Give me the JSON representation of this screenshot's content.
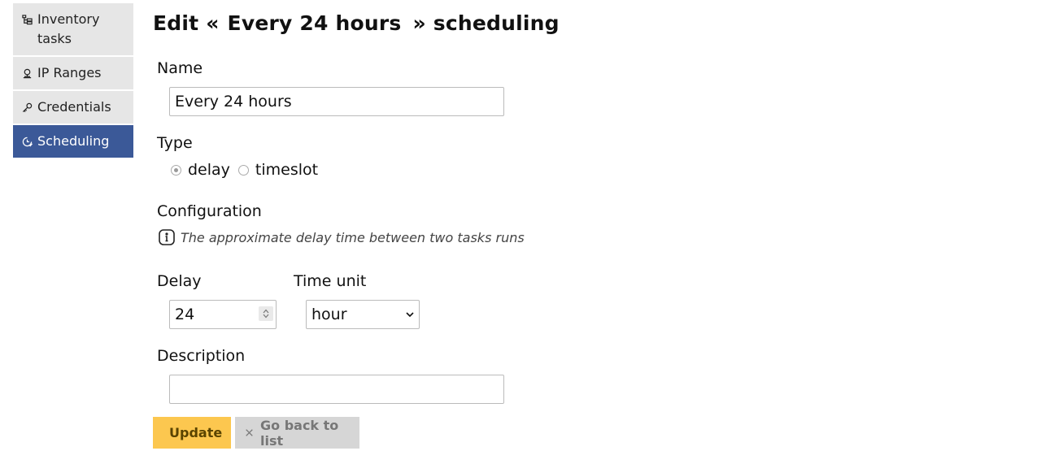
{
  "sidebar": {
    "items": [
      {
        "label": "Inventory tasks",
        "icon": "inventory-tasks-icon",
        "active": false
      },
      {
        "label": "IP Ranges",
        "icon": "ip-ranges-icon",
        "active": false
      },
      {
        "label": "Credentials",
        "icon": "key-icon",
        "active": false
      },
      {
        "label": "Scheduling",
        "icon": "clock-check-icon",
        "active": true
      }
    ]
  },
  "header": {
    "prefix": "Edit «",
    "name": "Every 24 hours",
    "suffix": "» scheduling"
  },
  "form": {
    "name_label": "Name",
    "name_value": "Every 24 hours",
    "type_label": "Type",
    "type_options": [
      {
        "label": "delay",
        "checked": true
      },
      {
        "label": "timeslot",
        "checked": false
      }
    ],
    "configuration_label": "Configuration",
    "configuration_hint": "The approximate delay time between two tasks runs",
    "delay_label": "Delay",
    "delay_value": "24",
    "time_unit_label": "Time unit",
    "time_unit_value": "hour",
    "description_label": "Description",
    "description_value": ""
  },
  "actions": {
    "update_label": "Update",
    "back_label": "Go back to list"
  },
  "colors": {
    "sidebar_active": "#3b5998",
    "sidebar_inactive": "#e6e6e6",
    "update_button": "#fcc74f",
    "back_button": "#d6d6d6"
  }
}
